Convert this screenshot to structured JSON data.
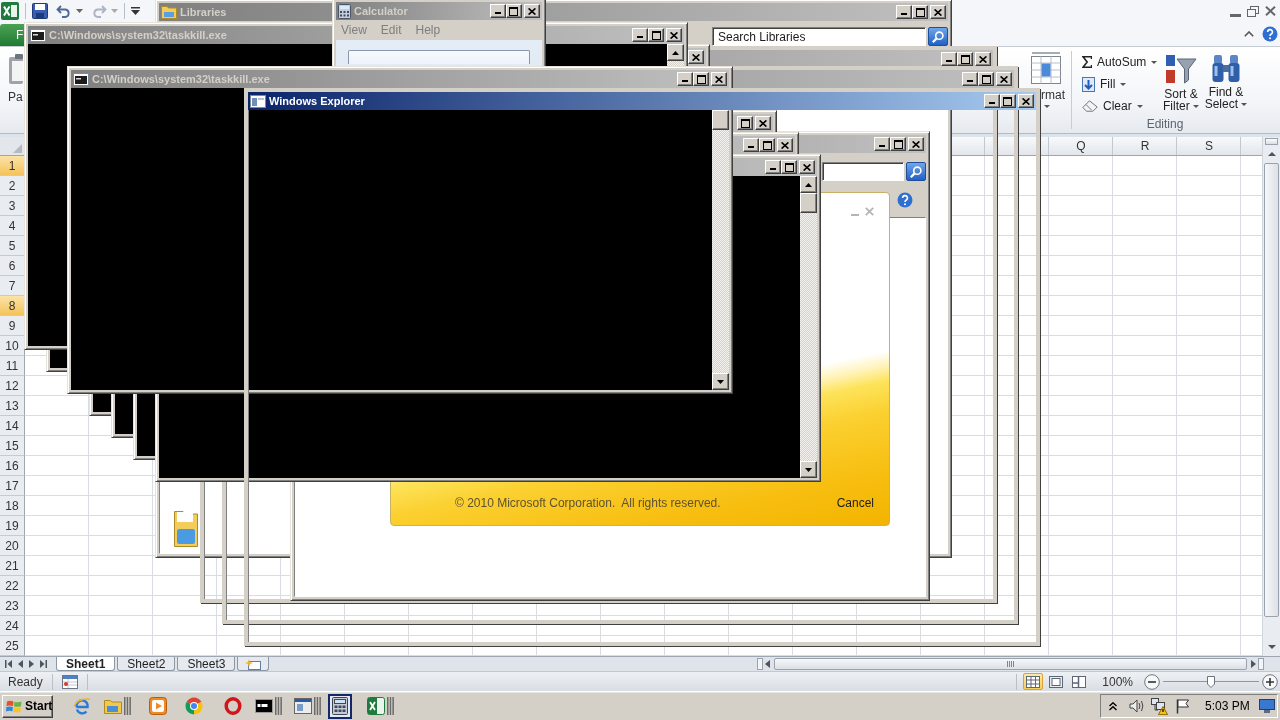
{
  "excel": {
    "file_tab": "F",
    "paste_label": "Pa",
    "format_label": "rmat",
    "editing": {
      "autosum": "AutoSum",
      "fill": "Fill",
      "clear": "Clear",
      "sort_filter": "Sort & Filter",
      "find_select": "Find & Select",
      "label": "Editing"
    },
    "columns": [
      "Q",
      "R",
      "S"
    ],
    "rows": [
      {
        "label": "1",
        "selected": true
      },
      {
        "label": "2",
        "selected": false
      },
      {
        "label": "3",
        "selected": false
      },
      {
        "label": "4",
        "selected": false
      },
      {
        "label": "5",
        "selected": false
      },
      {
        "label": "6",
        "selected": false
      },
      {
        "label": "7",
        "selected": false
      },
      {
        "label": "8",
        "selected": true
      },
      {
        "label": "9",
        "selected": false
      },
      {
        "label": "10",
        "selected": false
      },
      {
        "label": "11",
        "selected": false
      },
      {
        "label": "12",
        "selected": false
      },
      {
        "label": "13",
        "selected": false
      },
      {
        "label": "14",
        "selected": false
      },
      {
        "label": "15",
        "selected": false
      },
      {
        "label": "16",
        "selected": false
      },
      {
        "label": "17",
        "selected": false
      },
      {
        "label": "18",
        "selected": false
      },
      {
        "label": "19",
        "selected": false
      },
      {
        "label": "20",
        "selected": false
      },
      {
        "label": "21",
        "selected": false
      },
      {
        "label": "22",
        "selected": false
      },
      {
        "label": "23",
        "selected": false
      },
      {
        "label": "24",
        "selected": false
      },
      {
        "label": "25",
        "selected": false
      }
    ],
    "sheet_tabs": [
      {
        "label": "Sheet1",
        "selected": true
      },
      {
        "label": "Sheet2",
        "selected": false
      },
      {
        "label": "Sheet3",
        "selected": false
      }
    ],
    "status": "Ready",
    "views": [
      {
        "kind": "normal",
        "selected": true
      },
      {
        "kind": "page_layout",
        "selected": false
      },
      {
        "kind": "page_break",
        "selected": false
      }
    ],
    "zoom": {
      "reading": "100%",
      "level": 0.5
    }
  },
  "windows": [
    {
      "kind": "explorer",
      "title": "Libraries",
      "active": false,
      "search": {
        "placeholder": "Search Libraries"
      }
    },
    {
      "kind": "ghost",
      "active": false
    },
    {
      "kind": "ghost",
      "active": false
    },
    {
      "kind": "explorer",
      "active": false
    },
    {
      "kind": "console"
    },
    {
      "kind": "console",
      "active": false
    },
    {
      "kind": "console",
      "active": false
    },
    {
      "kind": "console",
      "active": false
    },
    {
      "kind": "console",
      "active": false
    },
    {
      "kind": "console",
      "title": "C:\\Windows\\system32\\taskkill.exe",
      "active": false
    },
    {
      "kind": "calculator",
      "title": "Calculator",
      "active": false,
      "menu": [
        "View",
        "Edit",
        "Help"
      ]
    },
    {
      "kind": "console",
      "title": "C:\\Windows\\system32\\taskkill.exe",
      "active": false
    },
    {
      "kind": "ghost",
      "title": "Windows Explorer",
      "active": true
    }
  ],
  "splash": {
    "copyright": "© 2010 Microsoft Corporation.  All rights reserved.",
    "cancel": "Cancel"
  },
  "taskbar": {
    "start": "Start",
    "buttons": [
      {
        "kind": "e_browser",
        "selected": false,
        "stacked": false
      },
      {
        "kind": "folder",
        "selected": false,
        "stacked": true
      },
      {
        "kind": "media_player",
        "selected": false,
        "stacked": false
      },
      {
        "kind": "round_browser",
        "selected": false,
        "stacked": false
      },
      {
        "kind": "ring_browser",
        "selected": false,
        "stacked": false
      },
      {
        "kind": "console",
        "selected": false,
        "stacked": true
      },
      {
        "kind": "window",
        "selected": false,
        "stacked": true
      },
      {
        "kind": "calculator",
        "selected": true,
        "stacked": false
      },
      {
        "kind": "spreadsheet",
        "selected": false,
        "stacked": true
      }
    ],
    "clock": "5:03 PM"
  }
}
